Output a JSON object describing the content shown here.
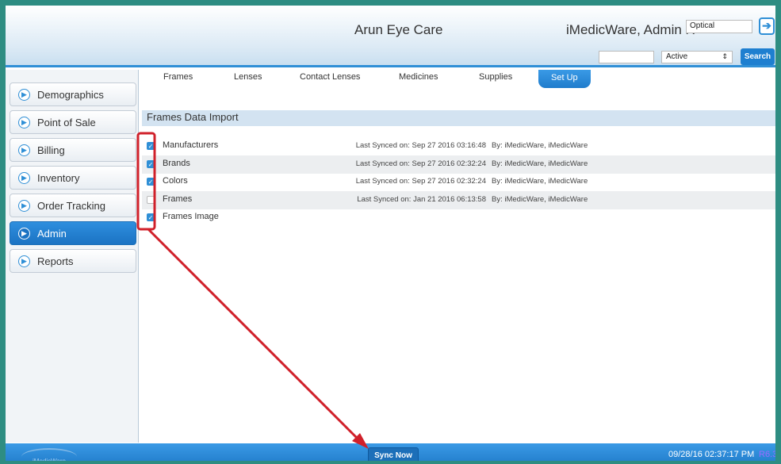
{
  "header": {
    "practice_name": "Arun Eye Care",
    "user_name": "iMedicWare, Admin R",
    "location": "Optical",
    "status_selected": "Active",
    "search_button": "Search"
  },
  "sidebar": {
    "items": [
      {
        "label": "Demographics",
        "active": false
      },
      {
        "label": "Point of Sale",
        "active": false
      },
      {
        "label": "Billing",
        "active": false
      },
      {
        "label": "Inventory",
        "active": false
      },
      {
        "label": "Order Tracking",
        "active": false
      },
      {
        "label": "Admin",
        "active": true
      },
      {
        "label": "Reports",
        "active": false
      }
    ]
  },
  "tabs": [
    {
      "label": "Frames",
      "active": false
    },
    {
      "label": "Lenses",
      "active": false
    },
    {
      "label": "Contact Lenses",
      "active": false
    },
    {
      "label": "Medicines",
      "active": false
    },
    {
      "label": "Supplies",
      "active": false
    },
    {
      "label": "Set Up",
      "active": true
    }
  ],
  "main": {
    "section_title": "Frames Data Import",
    "rows": [
      {
        "name": "Manufacturers",
        "checked": true,
        "synced": "Last Synced on: Sep 27 2016 03:16:48",
        "by": "By: iMedicWare, iMedicWare"
      },
      {
        "name": "Brands",
        "checked": true,
        "synced": "Last Synced on: Sep 27 2016 02:32:24",
        "by": "By: iMedicWare, iMedicWare"
      },
      {
        "name": "Colors",
        "checked": true,
        "synced": "Last Synced on: Sep 27 2016 02:32:24",
        "by": "By: iMedicWare, iMedicWare"
      },
      {
        "name": "Frames",
        "checked": false,
        "synced": "Last Synced on: Jan 21 2016 06:13:58",
        "by": "By: iMedicWare, iMedicWare"
      },
      {
        "name": "Frames Image",
        "checked": true,
        "synced": "",
        "by": ""
      }
    ]
  },
  "footer": {
    "logo_text": "iMedicWare",
    "sync_button": "Sync Now",
    "datetime": "09/28/16  02:37:17 PM",
    "version": "R6.3.7"
  },
  "colors": {
    "accent": "#2f8fd6",
    "frame_border": "#2e8d82",
    "annotation": "#d0202a"
  }
}
